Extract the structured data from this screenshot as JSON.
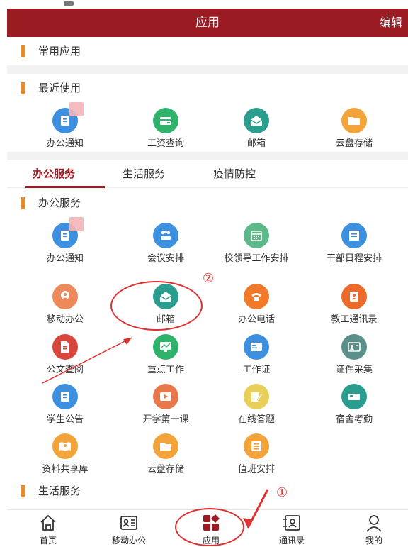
{
  "header": {
    "title": "应用",
    "edit_label": "编辑"
  },
  "sections": {
    "common": "常用应用",
    "recent": "最近使用",
    "office": "办公服务",
    "life": "生活服务"
  },
  "recent_items": [
    {
      "label": "办公通知",
      "icon": "clipboard-icon",
      "color": "#3d8fe0"
    },
    {
      "label": "工资查询",
      "icon": "card-icon",
      "color": "#2fb36b"
    },
    {
      "label": "邮箱",
      "icon": "mail-icon",
      "color": "#2a9d8f"
    },
    {
      "label": "云盘存储",
      "icon": "folder-icon",
      "color": "#f2a33a"
    }
  ],
  "tabs": [
    {
      "label": "办公服务",
      "active": true
    },
    {
      "label": "生活服务",
      "active": false
    },
    {
      "label": "疫情防控",
      "active": false
    }
  ],
  "office_items": [
    {
      "label": "办公通知",
      "icon": "clipboard-icon",
      "color": "#3d8fe0"
    },
    {
      "label": "会议安排",
      "icon": "meeting-icon",
      "color": "#3d8fe0"
    },
    {
      "label": "校领导工作安排",
      "icon": "calendar-icon",
      "color": "#5bb98a"
    },
    {
      "label": "干部日程安排",
      "icon": "document-icon",
      "color": "#3d8fe0"
    },
    {
      "label": "移动办公",
      "icon": "user-icon",
      "color": "#ee8a5a"
    },
    {
      "label": "邮箱",
      "icon": "mail-icon",
      "color": "#2a9d8f"
    },
    {
      "label": "办公电话",
      "icon": "phone-icon",
      "color": "#f07a2a"
    },
    {
      "label": "教工通讯录",
      "icon": "contacts-icon",
      "color": "#ee6a2a"
    },
    {
      "label": "公文查阅",
      "icon": "file-icon",
      "color": "#d9463b"
    },
    {
      "label": "重点工作",
      "icon": "chart-icon",
      "color": "#2fb36b"
    },
    {
      "label": "工作证",
      "icon": "badge-icon",
      "color": "#3d8fe0"
    },
    {
      "label": "证件采集",
      "icon": "id-card-icon",
      "color": "#5a8f8a"
    },
    {
      "label": "学生公告",
      "icon": "clipboard-icon",
      "color": "#3d8fe0"
    },
    {
      "label": "开学第一课",
      "icon": "play-icon",
      "color": "#e8784a"
    },
    {
      "label": "在线答题",
      "icon": "edit-icon",
      "color": "#e8cf5a"
    },
    {
      "label": "宿舍考勤",
      "icon": "bed-icon",
      "color": "#2a9d8f"
    },
    {
      "label": "资料共享库",
      "icon": "book-icon",
      "color": "#f2a33a"
    },
    {
      "label": "云盘存储",
      "icon": "folder-icon",
      "color": "#f2a33a"
    },
    {
      "label": "值班安排",
      "icon": "list-icon",
      "color": "#f2a33a"
    }
  ],
  "bottom_nav": [
    {
      "label": "首页",
      "icon": "home-icon"
    },
    {
      "label": "移动办公",
      "icon": "office-icon"
    },
    {
      "label": "应用",
      "icon": "apps-icon",
      "active": true
    },
    {
      "label": "通讯录",
      "icon": "address-book-icon"
    },
    {
      "label": "我的",
      "icon": "profile-icon"
    }
  ],
  "annotations": {
    "mark1": "①",
    "mark2": "②"
  },
  "colors": {
    "brand": "#9a1b22",
    "accent_bar": "#e88a2e",
    "annotation": "#e03030"
  }
}
